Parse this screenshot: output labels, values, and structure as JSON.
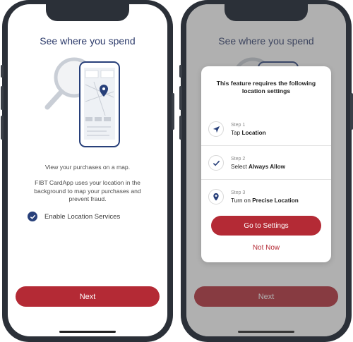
{
  "left_screen": {
    "title": "See where you spend",
    "description": "View your purchases on a map.",
    "detail": "FIBT CardApp uses your location in the background to map your purchases and prevent fraud.",
    "checkbox_label": "Enable Location Services",
    "checkbox_checked": true,
    "next_label": "Next"
  },
  "right_screen": {
    "title": "See where you spend",
    "modal": {
      "title_line1": "This feature requires the following",
      "title_line2": "location settings",
      "steps": [
        {
          "number": "Step 1",
          "prefix": "Tap ",
          "bold": "Location",
          "icon": "location-arrow-icon"
        },
        {
          "number": "Step 2",
          "prefix": "Select ",
          "bold": "Always Allow",
          "icon": "checkmark-icon"
        },
        {
          "number": "Step 3",
          "prefix": "Turn on ",
          "bold": "Precise Location",
          "icon": "map-pin-icon"
        }
      ],
      "settings_label": "Go to Settings",
      "not_now_label": "Not Now"
    },
    "next_label": "Next"
  },
  "colors": {
    "accent_red": "#b42a35",
    "navy": "#28407a",
    "title_blue": "#2d3b6b"
  }
}
